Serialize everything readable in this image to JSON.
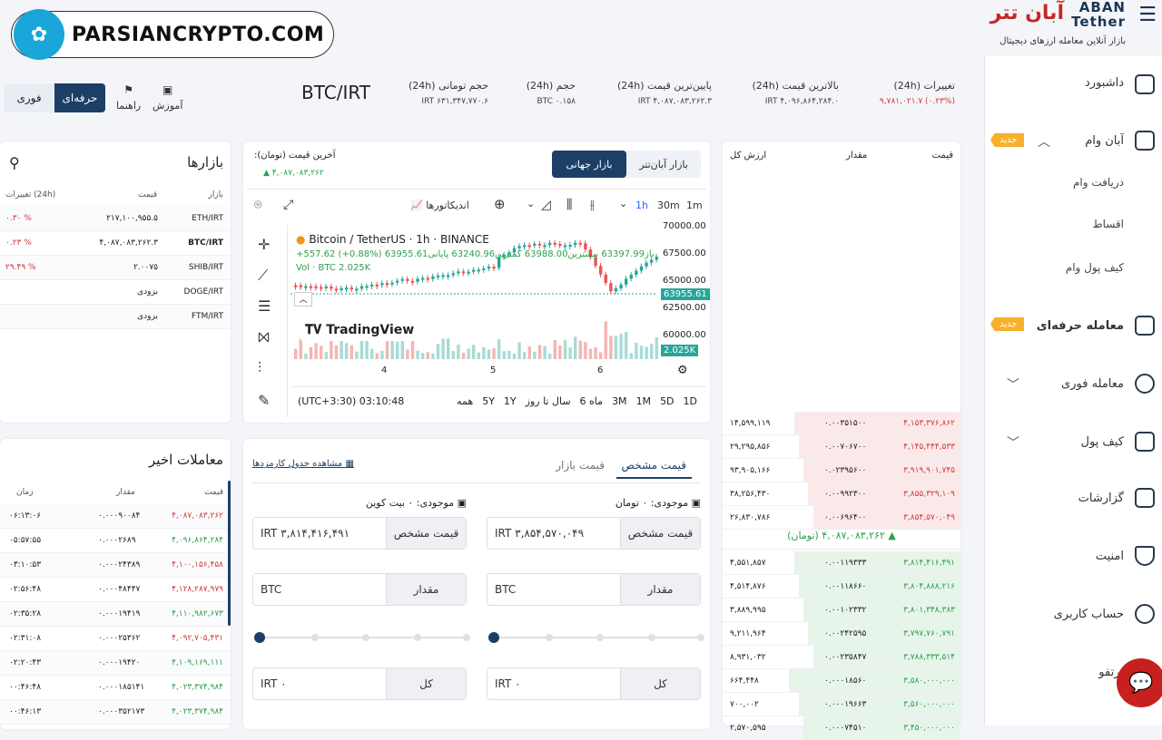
{
  "watermark": {
    "text": "PARSIANCRYPTO.COM"
  },
  "brand": {
    "name_en": "ABAN Tether",
    "name_fa": "آبان تتر",
    "tagline": "بازار آنلاین معامله ارزهای دیجیتال"
  },
  "sidebar": {
    "items": [
      {
        "label": "داشبورد",
        "icon": "dashboard-icon"
      },
      {
        "label": "آبان وام",
        "icon": "loan-icon",
        "badge": "جدید",
        "sub": [
          "دریافت وام",
          "اقساط",
          "کیف پول وام"
        ]
      },
      {
        "label": "معامله حرفه‌ای",
        "icon": "pro-trade-icon",
        "badge": "جدید"
      },
      {
        "label": "معامله فوری",
        "icon": "instant-trade-icon"
      },
      {
        "label": "کیف پول",
        "icon": "wallet-icon"
      },
      {
        "label": "گزارشات",
        "icon": "reports-icon"
      },
      {
        "label": "امنیت",
        "icon": "shield-icon"
      },
      {
        "label": "حساب کاربری",
        "icon": "user-icon"
      },
      {
        "label": "پرتفو",
        "icon": "portfolio-icon"
      }
    ]
  },
  "header": {
    "pair": "BTC/IRT",
    "stats": [
      {
        "label": "تغییرات (24h)",
        "value": "(۰.۲۳%) ۹,۷۸۱,۰۲۱.۷"
      },
      {
        "label": "بالاترین قیمت (24h)",
        "value": "۴,۰۹۶,۸۶۴,۲۸۴.۰ IRT"
      },
      {
        "label": "پایین‌ترین قیمت (24h)",
        "value": "۴,۰۸۷,۰۸۳,۲۶۲.۳ IRT"
      },
      {
        "label": "حجم (24h)",
        "value": "۰.۱۵۸ BTC"
      },
      {
        "label": "حجم تومانی (24h)",
        "value": "۶۳۱,۳۴۷,۷۷۰.۶ IRT"
      }
    ],
    "links": [
      {
        "label": "آموزش",
        "icon": "video-icon"
      },
      {
        "label": "راهنما",
        "icon": "guide-icon"
      }
    ],
    "modes": {
      "pro": "حرفه‌ای",
      "instant": "فوری"
    }
  },
  "markets": {
    "title": "بازارها",
    "headers": {
      "market": "بازار",
      "price": "قیمت",
      "change": "تغییرات (24h)"
    },
    "rows": [
      {
        "market": "ETH/IRT",
        "price": "۲۱۷,۱۰۰,۹۵۵.۵",
        "change": "۰.۳۰ %",
        "dir": "red"
      },
      {
        "market": "BTC/IRT",
        "price": "۴,۰۸۷,۰۸۳,۲۶۲.۳",
        "change": "۰.۲۳ %",
        "dir": "red"
      },
      {
        "market": "SHIB/IRT",
        "price": "۲.۰۰۷۵",
        "change": "۲۹.۴۹ %",
        "dir": "red"
      },
      {
        "market": "DOGE/IRT",
        "price": "بزودی",
        "change": ""
      },
      {
        "market": "FTM/IRT",
        "price": "بزودی",
        "change": ""
      }
    ]
  },
  "chart_panel": {
    "tabs": {
      "aban": "بازار آبان‌تتر",
      "global": "بازار جهانی"
    },
    "last_price_label": "آخرین قیمت (تومان):",
    "last_price": "▲ ۴,۰۸۷,۰۸۳,۲۶۲",
    "toolbar": {
      "intervals": [
        "1m",
        "30m",
        "1h"
      ],
      "indicators": "اندیکاتورها"
    },
    "legend": {
      "title": "Bitcoin / TetherUS · 1h · BINANCE",
      "ohlc": "باز63397.99 بیشترین63988.00 کمترین63240.96 پایانی63955.61",
      "change": "+557.62 (+0.88%)",
      "vol": "Vol · BTC  2.025K"
    },
    "price_axis": [
      "70000.00",
      "67500.00",
      "65000.00",
      "62500.00",
      "60000.00"
    ],
    "price_tag": "63955.61",
    "vol_tag": "2.025K",
    "x_axis": [
      "4",
      "5",
      "6"
    ],
    "watermark": "TradingView",
    "time": "(UTC+3:30) 03:10:48",
    "ranges": [
      "1D",
      "5D",
      "1M",
      "3M",
      "6 ماه",
      "سال تا روز",
      "1Y",
      "5Y",
      "همه"
    ]
  },
  "orderbook": {
    "headers": {
      "price": "قیمت",
      "amount": "مقدار",
      "total": "ارزش کل"
    },
    "asks": [
      {
        "price": "۴,۱۵۳,۳۷۶,۸۶۲",
        "amount": "۰.۰۰۳۵۱۵۰۰",
        "total": "۱۴,۵۹۹,۱۱۹"
      },
      {
        "price": "۴,۱۴۵,۴۴۴,۵۳۳",
        "amount": "۰.۰۰۷۰۶۷۰۰",
        "total": "۲۹,۲۹۵,۸۵۶"
      },
      {
        "price": "۳,۹۱۹,۹۰۱,۷۴۵",
        "amount": "۰.۰۲۳۹۵۶۰۰",
        "total": "۹۳,۹۰۵,۱۶۶"
      },
      {
        "price": "۳,۸۵۵,۳۲۹,۱۰۹",
        "amount": "۰.۰۰۹۹۲۳۰۰",
        "total": "۳۸,۲۵۶,۴۳۰"
      },
      {
        "price": "۳,۸۵۴,۵۷۰,۰۴۹",
        "amount": "۰.۰۰۶۹۶۴۰۰",
        "total": "۲۶,۸۳۰,۷۸۶"
      }
    ],
    "mid": "۴,۰۸۷,۰۸۳,۲۶۲ (تومان)",
    "bids": [
      {
        "price": "۳,۸۱۴,۴۱۶,۴۹۱",
        "amount": "۰.۰۰۱۱۹۳۳۳",
        "total": "۴,۵۵۱,۸۵۷"
      },
      {
        "price": "۳,۸۰۴,۸۸۸,۲۱۶",
        "amount": "۰.۰۰۱۱۸۶۶۰",
        "total": "۴,۵۱۴,۸۷۶"
      },
      {
        "price": "۳,۸۰۱,۳۴۸,۳۸۳",
        "amount": "۰.۰۰۱۰۲۳۳۲",
        "total": "۳,۸۸۹,۹۹۵"
      },
      {
        "price": "۳,۷۹۷,۷۶۰,۷۹۱",
        "amount": "۰.۰۰۲۴۲۵۹۵",
        "total": "۹,۲۱۱,۹۶۴"
      },
      {
        "price": "۳,۷۸۸,۳۳۳,۵۱۴",
        "amount": "۰.۰۰۲۳۵۸۴۷",
        "total": "۸,۹۳۱,۰۳۲"
      },
      {
        "price": "۳,۵۸۰,۰۰۰,۰۰۰",
        "amount": "۰.۰۰۰۱۸۵۶۰",
        "total": "۶۶۴,۴۴۸"
      },
      {
        "price": "۳,۵۶۰,۰۰۰,۰۰۰",
        "amount": "۰.۰۰۰۱۹۶۶۳",
        "total": "۷۰۰,۰۰۲"
      },
      {
        "price": "۳,۴۵۰,۰۰۰,۰۰۰",
        "amount": "۰.۰۰۰۷۴۵۱۰",
        "total": "۲,۵۷۰,۵۹۵"
      }
    ]
  },
  "trades": {
    "title": "معاملات اخیر",
    "headers": {
      "price": "قیمت",
      "amount": "مقدار",
      "time": "زمان"
    },
    "rows": [
      {
        "price": "۴,۰۸۷,۰۸۳,۲۶۲",
        "amount": "۰.۰۰۰۹۰۰۸۴",
        "time": "۰۶:۱۳:۰۶",
        "dir": "red"
      },
      {
        "price": "۴,۰۹۶,۸۶۴,۲۸۴",
        "amount": "۰.۰۰۰۲۶۸۹",
        "time": "۰۵:۵۷:۵۵",
        "dir": "green"
      },
      {
        "price": "۴,۱۰۰,۱۵۶,۴۵۸",
        "amount": "۰.۰۰۰۲۴۳۸۹",
        "time": "۰۳:۱۰:۵۳",
        "dir": "red"
      },
      {
        "price": "۴,۱۲۸,۲۸۷,۹۷۹",
        "amount": "۰.۰۰۰۴۸۴۴۷",
        "time": "۰۲:۵۶:۴۸",
        "dir": "red"
      },
      {
        "price": "۴,۱۱۰,۹۸۲,۶۷۳",
        "amount": "۰.۰۰۰۱۹۴۱۹",
        "time": "۰۲:۳۵:۲۸",
        "dir": "green"
      },
      {
        "price": "۴,۰۹۲,۷۰۵,۴۳۱",
        "amount": "۰.۰۰۰۲۵۳۶۲",
        "time": "۰۲:۳۱:۰۸",
        "dir": "red"
      },
      {
        "price": "۴,۱۰۹,۱۶۹,۱۱۱",
        "amount": "۰.۰۰۰۱۹۴۲۰",
        "time": "۰۲:۲۰:۴۳",
        "dir": "green"
      },
      {
        "price": "۴,۰۲۳,۳۷۴,۹۸۴",
        "amount": "۰.۰۰۰۱۸۵۱۴۱",
        "time": "۰۰:۴۶:۴۸",
        "dir": "green"
      },
      {
        "price": "۴,۰۲۳,۳۷۴,۹۸۴",
        "amount": "۰.۰۰۰۳۵۲۱۷۳",
        "time": "۰۰:۴۶:۱۳",
        "dir": "green"
      }
    ]
  },
  "order_form": {
    "tabs": {
      "limit": "قیمت مشخص",
      "market": "قیمت بازار"
    },
    "fee_link": "مشاهده جدول کارمزدها",
    "buy": {
      "balance": "موجودی: ۰ تومان",
      "price_label": "قیمت مشخص",
      "price_value": "IRT  ۳,۸۵۴,۵۷۰,۰۴۹",
      "amount_label": "مقدار",
      "amount_unit": "BTC",
      "total_label": "کل",
      "total_value": "IRT  ۰"
    },
    "sell": {
      "balance": "موجودی: ۰ بیت کوین",
      "price_label": "قیمت مشخص",
      "price_value": "IRT  ۳,۸۱۴,۴۱۶,۴۹۱",
      "amount_label": "مقدار",
      "amount_unit": "BTC",
      "total_label": "کل",
      "total_value": "IRT  ۰"
    }
  },
  "colors": {
    "accent": "#1d3f66",
    "green": "#2e9e4e",
    "red": "#d33a3a",
    "badge": "#f7b02c"
  }
}
